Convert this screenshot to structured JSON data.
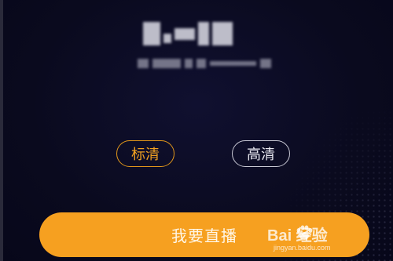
{
  "quality_options": {
    "standard": {
      "label": "标清",
      "selected": true
    },
    "high": {
      "label": "高清",
      "selected": false
    }
  },
  "actions": {
    "go_live_label": "我要直播"
  },
  "watermark": {
    "brand": "Bai 经验",
    "url": "jingyan.baidu.com"
  },
  "colors": {
    "background": "#0a0a1e",
    "accent": "#f6a020",
    "selected_border": "#e0961a",
    "unselected_border": "#c8c8d4"
  }
}
